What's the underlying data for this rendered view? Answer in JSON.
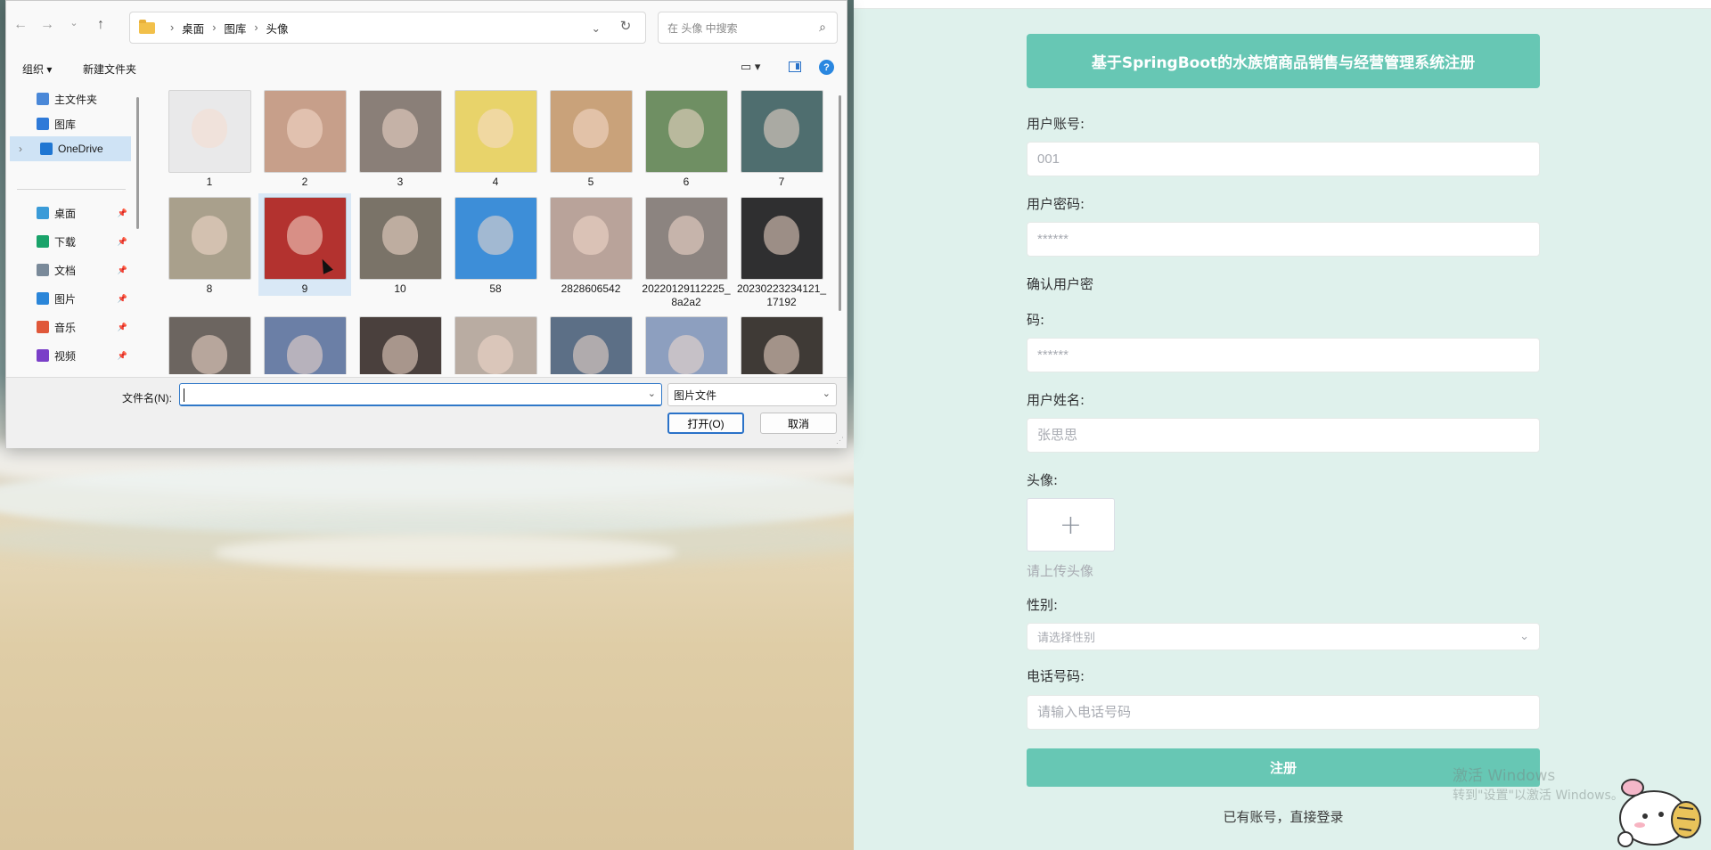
{
  "file_dialog": {
    "breadcrumb": [
      "桌面",
      "图库",
      "头像"
    ],
    "search_placeholder": "在 头像 中搜索",
    "toolbar": {
      "organize": "组织",
      "new_folder": "新建文件夹"
    },
    "sidebar": {
      "top_items": [
        {
          "label": "主文件夹",
          "icon": "home-icon",
          "color": "#4a88d8"
        },
        {
          "label": "图库",
          "icon": "gallery-icon",
          "color": "#2f7ad8"
        },
        {
          "label": "OneDrive",
          "icon": "cloud-icon",
          "color": "#1f76d2",
          "selected": true
        }
      ],
      "quick_items": [
        {
          "label": "桌面",
          "icon": "desktop-icon",
          "color": "#3a9bd8"
        },
        {
          "label": "下载",
          "icon": "download-icon",
          "color": "#1aa36a"
        },
        {
          "label": "文档",
          "icon": "document-icon",
          "color": "#7a8a9a"
        },
        {
          "label": "图片",
          "icon": "pictures-icon",
          "color": "#2b86d9"
        },
        {
          "label": "音乐",
          "icon": "music-icon",
          "color": "#e0583a"
        },
        {
          "label": "视频",
          "icon": "video-icon",
          "color": "#7a3fc8"
        }
      ]
    },
    "files": [
      {
        "name": "1",
        "color": "#e9e9ea"
      },
      {
        "name": "2",
        "color": "#c79f8a"
      },
      {
        "name": "3",
        "color": "#8a7f78"
      },
      {
        "name": "4",
        "color": "#e8d36a"
      },
      {
        "name": "5",
        "color": "#c9a27a"
      },
      {
        "name": "6",
        "color": "#6f8f63"
      },
      {
        "name": "7",
        "color": "#4f6e6f"
      },
      {
        "name": "8",
        "color": "#a9a08c"
      },
      {
        "name": "9",
        "color": "#b3322f",
        "selected": true
      },
      {
        "name": "10",
        "color": "#7a7368"
      },
      {
        "name": "58",
        "color": "#3d8ed8"
      },
      {
        "name": "2828606542",
        "color": "#b9a39a"
      },
      {
        "name": "20220129112225_8a2a2",
        "color": "#8c8480"
      },
      {
        "name": "20230223234121_17192",
        "color": "#2f2f30"
      },
      {
        "name": "",
        "color": "#6c6560"
      },
      {
        "name": "",
        "color": "#6b7fa6"
      },
      {
        "name": "",
        "color": "#4a403d"
      },
      {
        "name": "",
        "color": "#b9aca2"
      },
      {
        "name": "",
        "color": "#5c6f86"
      },
      {
        "name": "",
        "color": "#8d9fbf"
      },
      {
        "name": "",
        "color": "#3f3a36"
      }
    ],
    "filename_label": "文件名(N):",
    "filename_value": "",
    "filetype": "图片文件",
    "open_button": "打开(O)",
    "cancel_button": "取消"
  },
  "register_form": {
    "title": "基于SpringBoot的水族馆商品销售与经营管理系统注册",
    "account_label": "用户账号:",
    "account_placeholder": "001",
    "password_label": "用户密码:",
    "password_placeholder": "******",
    "confirm_label_line1": "确认用户密",
    "confirm_label_line2": "码:",
    "confirm_placeholder": "******",
    "name_label": "用户姓名:",
    "name_placeholder": "张思思",
    "avatar_label": "头像:",
    "avatar_hint": "请上传头像",
    "gender_label": "性别:",
    "gender_placeholder": "请选择性别",
    "phone_label": "电话号码:",
    "phone_placeholder": "请输入电话号码",
    "submit": "注册",
    "login_link": "已有账号，直接登录",
    "accent_color": "#67c7b4"
  },
  "watermark": {
    "line1": "激活 Windows",
    "line2": "转到\"设置\"以激活 Windows。"
  }
}
